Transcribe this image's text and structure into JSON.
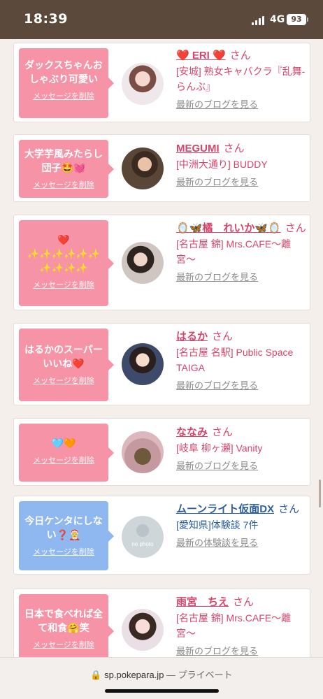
{
  "status_bar": {
    "time": "18:39",
    "network": "4G",
    "battery": "93"
  },
  "feed": {
    "items": [
      {
        "message": "ダックスちゃんおしゃぶり可愛い",
        "delete_label": "メッセージを削除",
        "name": "❤️ ERI ❤️",
        "san": "さん",
        "shop": "[安城] 熟女キャバクラ『乱舞-らんぶ』",
        "link": "最新のブログを見る",
        "bubble_color": "#f693a6"
      },
      {
        "message": "大学芋風みたらし団子🤩💓",
        "delete_label": "メッセージを削除",
        "name": "MEGUMI",
        "san": "さん",
        "shop": "[中洲大通り] BUDDY",
        "link": "最新のブログを見る",
        "bubble_color": "#f693a6"
      },
      {
        "message": "❤️ ✨✨✨✨✨✨ ✨✨✨✨",
        "delete_label": "メッセージを削除",
        "name": "🪞🦋橘　れいか🦋🪞",
        "san": "さん",
        "shop": "[名古屋 錦] Mrs.CAFE〜離宮〜",
        "link": "最新のブログを見る",
        "bubble_color": "#f693a6"
      },
      {
        "message": "はるかのスーパーいいね❤️",
        "delete_label": "メッセージを削除",
        "name": "はるか",
        "san": "さん",
        "shop": "[名古屋 名駅] Public Space TAIGA",
        "link": "最新のブログを見る",
        "bubble_color": "#f693a6"
      },
      {
        "message": "🩵🧡",
        "delete_label": "メッセージを削除",
        "name": "ななみ",
        "san": "さん",
        "shop": "[岐阜 柳ヶ瀬] Vanity",
        "link": "最新のブログを見る",
        "bubble_color": "#f693a6"
      },
      {
        "message": "今日ケンタにしない❓🤶",
        "delete_label": "メッセージを削除",
        "name": "ムーンライト仮面DX",
        "san": "さん",
        "shop": "[愛知県]体験談 7件",
        "link": "最新の体験談を見る",
        "bubble_color": "#8fb8f1",
        "avatar_text": "no photo"
      },
      {
        "message": "日本で食べれば全て和食🤗笑",
        "delete_label": "メッセージを削除",
        "name": "雨宮　ちえ",
        "san": "さん",
        "shop": "[名古屋 錦] Mrs.CAFE〜離宮〜",
        "link": "最新のブログを見る",
        "bubble_color": "#f693a6"
      }
    ]
  },
  "browser": {
    "url": "sp.pokepara.jp",
    "mode": "— プライベート"
  }
}
